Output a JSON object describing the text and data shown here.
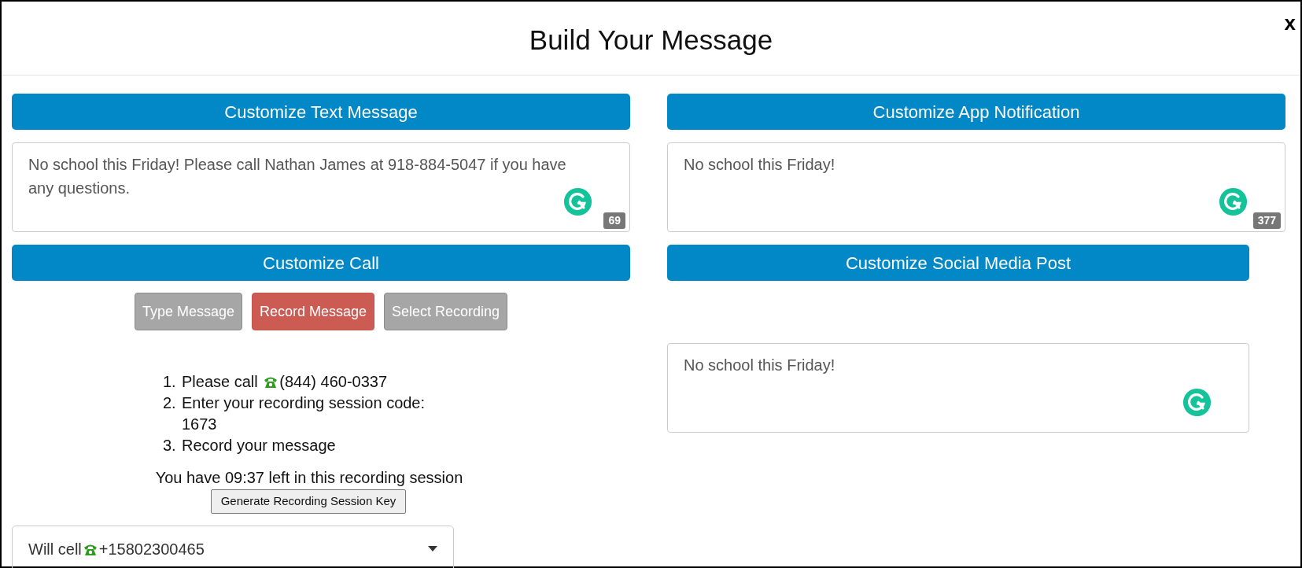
{
  "window": {
    "title": "Build Your Message",
    "close": "x"
  },
  "text_message": {
    "header": "Customize Text Message",
    "value": "No school this Friday! Please call Nathan James at 918-884-5047 if you have any questions.",
    "count": "69"
  },
  "app_notification": {
    "header": "Customize App Notification",
    "value": "No school this Friday!",
    "count": "377"
  },
  "call": {
    "header": "Customize Call",
    "modes": [
      {
        "label": "Type Message",
        "selected": false
      },
      {
        "label": "Record Message",
        "selected": true
      },
      {
        "label": "Select Recording",
        "selected": false
      }
    ],
    "steps": [
      {
        "number": "1.",
        "text": "Please call",
        "phone": "(844) 460-0337"
      },
      {
        "number": "2.",
        "text": "Enter your recording session code: 1673"
      },
      {
        "number": "3.",
        "text": "Record your message"
      }
    ],
    "timer": "You have 09:37 left in this recording session",
    "generate_button": "Generate Recording Session Key",
    "select": {
      "text": "Will cell",
      "phone": "+15802300465"
    }
  },
  "social_media": {
    "header": "Customize Social Media Post",
    "value": "No school this Friday!"
  }
}
